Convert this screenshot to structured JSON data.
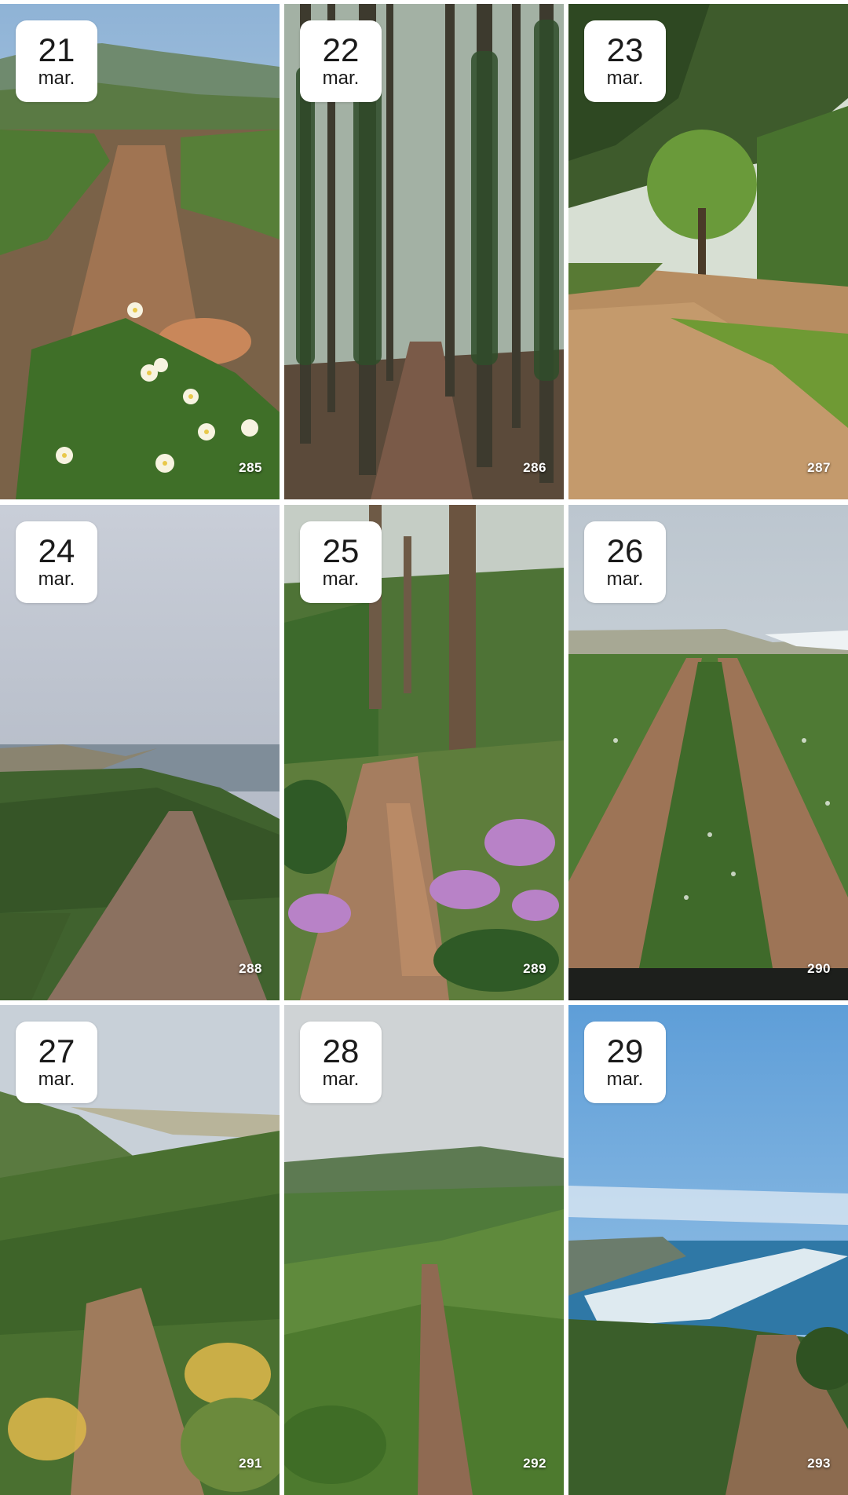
{
  "gallery": {
    "tiles": [
      {
        "day": "21",
        "month": "mar.",
        "count": "285",
        "scene": "trail-flowers"
      },
      {
        "day": "22",
        "month": "mar.",
        "count": "286",
        "scene": "tall-forest"
      },
      {
        "day": "23",
        "month": "mar.",
        "count": "287",
        "scene": "dirt-road-trees"
      },
      {
        "day": "24",
        "month": "mar.",
        "count": "288",
        "scene": "foggy-coast-trail"
      },
      {
        "day": "25",
        "month": "mar.",
        "count": "289",
        "scene": "pine-path-heather"
      },
      {
        "day": "26",
        "month": "mar.",
        "count": "290",
        "scene": "twin-track-coast"
      },
      {
        "day": "27",
        "month": "mar.",
        "count": "291",
        "scene": "shrub-hillside"
      },
      {
        "day": "28",
        "month": "mar.",
        "count": "292",
        "scene": "green-valley-path"
      },
      {
        "day": "29",
        "month": "mar.",
        "count": "293",
        "scene": "blue-sea-trail"
      }
    ]
  },
  "colors": {
    "badge_bg": "#ffffff",
    "badge_text": "#1a1a1a",
    "count_text": "#ffffff"
  }
}
